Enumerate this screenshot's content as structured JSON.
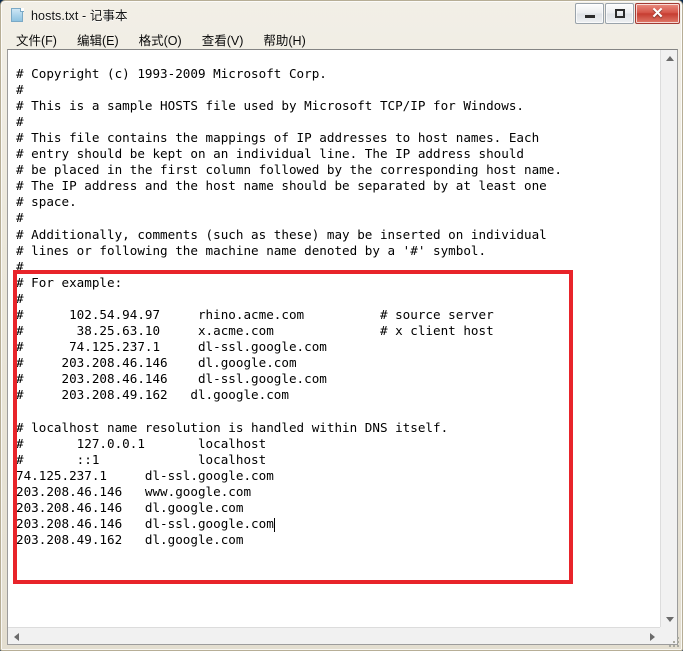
{
  "window": {
    "title": "hosts.txt - 记事本",
    "icon": "notepad-document-icon",
    "caption_buttons": {
      "minimize": "—",
      "maximize": "□",
      "close": "✕"
    }
  },
  "menubar": {
    "items": [
      {
        "label": "文件(F)",
        "name": "menu-file"
      },
      {
        "label": "编辑(E)",
        "name": "menu-edit"
      },
      {
        "label": "格式(O)",
        "name": "menu-format"
      },
      {
        "label": "查看(V)",
        "name": "menu-view"
      },
      {
        "label": "帮助(H)",
        "name": "menu-help"
      }
    ]
  },
  "editor": {
    "content": "# Copyright (c) 1993-2009 Microsoft Corp.\n#\n# This is a sample HOSTS file used by Microsoft TCP/IP for Windows.\n#\n# This file contains the mappings of IP addresses to host names. Each\n# entry should be kept on an individual line. The IP address should\n# be placed in the first column followed by the corresponding host name.\n# The IP address and the host name should be separated by at least one\n# space.\n#\n# Additionally, comments (such as these) may be inserted on individual\n# lines or following the machine name denoted by a '#' symbol.\n#\n# For example:\n#\n#      102.54.94.97     rhino.acme.com          # source server\n#       38.25.63.10     x.acme.com              # x client host\n#      74.125.237.1     dl-ssl.google.com\n#     203.208.46.146    dl.google.com\n#     203.208.46.146    dl-ssl.google.com\n#     203.208.49.162   dl.google.com\n\n# localhost name resolution is handled within DNS itself.\n#       127.0.0.1       localhost\n#       ::1             localhost\n74.125.237.1     dl-ssl.google.com\n203.208.46.146   www.google.com\n203.208.46.146   dl.google.com\n203.208.46.146   dl-ssl.google.com\n203.208.49.162   dl.google.com",
    "caret_after_text": "dl-ssl.google.com",
    "lines": [
      "# Copyright (c) 1993-2009 Microsoft Corp.",
      "#",
      "# This is a sample HOSTS file used by Microsoft TCP/IP for Windows.",
      "#",
      "# This file contains the mappings of IP addresses to host names. Each",
      "# entry should be kept on an individual line. The IP address should",
      "# be placed in the first column followed by the corresponding host name.",
      "# The IP address and the host name should be separated by at least one",
      "# space.",
      "#",
      "# Additionally, comments (such as these) may be inserted on individual",
      "# lines or following the machine name denoted by a '#' symbol.",
      "#",
      "# For example:",
      "#",
      "#      102.54.94.97     rhino.acme.com          # source server",
      "#       38.25.63.10     x.acme.com              # x client host",
      "#      74.125.237.1     dl-ssl.google.com",
      "#     203.208.46.146    dl.google.com",
      "#     203.208.46.146    dl-ssl.google.com",
      "#     203.208.49.162   dl.google.com",
      "",
      "# localhost name resolution is handled within DNS itself.",
      "#       127.0.0.1       localhost",
      "#       ::1             localhost",
      "74.125.237.1     dl-ssl.google.com",
      "203.208.46.146   www.google.com",
      "203.208.46.146   dl.google.com",
      "203.208.46.146   dl-ssl.google.com",
      "203.208.49.162   dl.google.com"
    ]
  },
  "annotation": {
    "highlight_color": "#e8242a",
    "shape": "rectangle",
    "covers_lines_from": "# For example:",
    "covers_lines_to": "203.208.49.162   dl.google.com"
  },
  "scrollbars": {
    "vertical": {
      "up_arrow": "▲",
      "down_arrow": "▼"
    },
    "horizontal": {
      "left_arrow": "◀",
      "right_arrow": "▶"
    }
  }
}
